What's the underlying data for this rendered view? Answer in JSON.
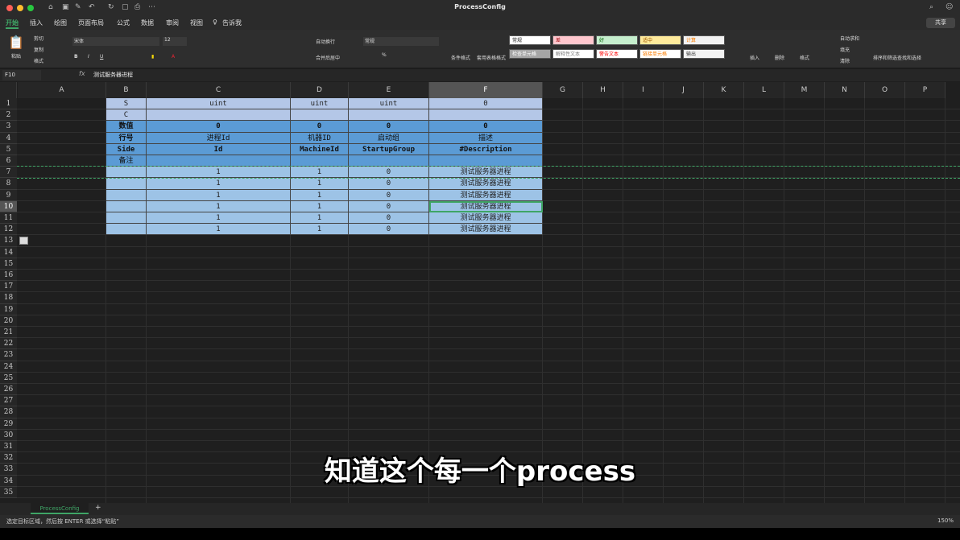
{
  "window": {
    "title": "ProcessConfig"
  },
  "tabs": [
    "开始",
    "插入",
    "绘图",
    "页面布局",
    "公式",
    "数据",
    "审阅",
    "视图",
    "告诉我"
  ],
  "share": "共享",
  "ribbon": {
    "paste": "粘贴",
    "cut": "剪切",
    "copy": "复制",
    "format": "格式",
    "font": "宋体",
    "size": "12",
    "wrap": "自动换行",
    "merge": "合并后居中",
    "numfmt": "常规",
    "cond": "条件格式",
    "table": "套用表格格式",
    "styles": [
      {
        "label": "常规",
        "bg": "#ffffff",
        "fg": "#222222"
      },
      {
        "label": "差",
        "bg": "#ffc7ce",
        "fg": "#9c0006"
      },
      {
        "label": "好",
        "bg": "#c6efce",
        "fg": "#006100"
      },
      {
        "label": "适中",
        "bg": "#ffeb9c",
        "fg": "#9c5700"
      },
      {
        "label": "计算",
        "bg": "#f2f2f2",
        "fg": "#fa7d00"
      },
      {
        "label": "检查单元格",
        "bg": "#a5a5a5",
        "fg": "#ffffff"
      },
      {
        "label": "解释性文本",
        "bg": "#ffffff",
        "fg": "#7f7f7f"
      },
      {
        "label": "警告文本",
        "bg": "#ffffff",
        "fg": "#ff0000"
      },
      {
        "label": "链接单元格",
        "bg": "#ffffff",
        "fg": "#fa7d00"
      },
      {
        "label": "输出",
        "bg": "#f2f2f2",
        "fg": "#3f3f3f"
      }
    ],
    "insert": "插入",
    "delete": "删除",
    "fmt": "格式",
    "autosum": "自动求和",
    "fill": "填充",
    "clear": "清除",
    "sort": "排序和筛选",
    "find": "查找和选择"
  },
  "formula": {
    "namebox": "F10",
    "fx": "fx",
    "value": "测试服务器进程"
  },
  "columns": [
    "A",
    "B",
    "C",
    "D",
    "E",
    "F",
    "G",
    "H",
    "I",
    "J",
    "K",
    "L",
    "M",
    "N",
    "O",
    "P"
  ],
  "rows": [
    "1",
    "2",
    "3",
    "4",
    "5",
    "6",
    "7",
    "8",
    "9",
    "10",
    "11",
    "12",
    "13",
    "14",
    "15",
    "16",
    "17",
    "18",
    "19",
    "20",
    "21",
    "22",
    "23",
    "24",
    "25",
    "26",
    "27",
    "28",
    "29",
    "30",
    "31",
    "32",
    "33",
    "34",
    "35"
  ],
  "cells": [
    [
      "S",
      "uint",
      "uint",
      "uint",
      "0"
    ],
    [
      "C",
      "",
      "",
      "",
      ""
    ],
    [
      "数值",
      "0",
      "0",
      "0",
      "0"
    ],
    [
      "行号",
      "进程Id",
      "机器ID",
      "启动组",
      "描述"
    ],
    [
      "Side",
      "Id",
      "MachineId",
      "StartupGroup",
      "#Description"
    ],
    [
      "备注",
      "",
      "",
      "",
      ""
    ],
    [
      "",
      "1",
      "1",
      "0",
      "测试服务器进程"
    ],
    [
      "",
      "1",
      "1",
      "0",
      "测试服务器进程"
    ],
    [
      "",
      "1",
      "1",
      "0",
      "测试服务器进程"
    ],
    [
      "",
      "1",
      "1",
      "0",
      "测试服务器进程"
    ],
    [
      "",
      "1",
      "1",
      "0",
      "测试服务器进程"
    ],
    [
      "",
      "1",
      "1",
      "0",
      "测试服务器进程"
    ]
  ],
  "sheet": {
    "name": "ProcessConfig",
    "add": "+"
  },
  "status": {
    "text": "选定目标区域，然后按 ENTER 或选择“粘贴”",
    "zoom": "150%"
  },
  "subtitle": "知道这个每一个process"
}
